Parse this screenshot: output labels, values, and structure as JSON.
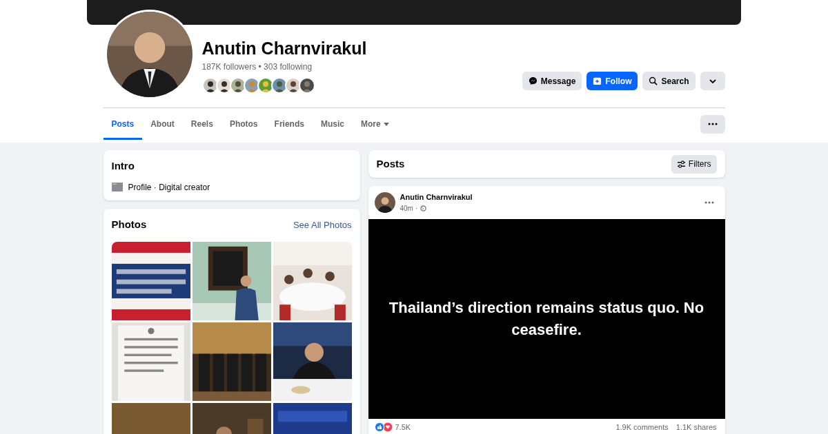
{
  "profile": {
    "name": "Anutin Charnvirakul",
    "stats": "187K followers • 303 following",
    "buttons": [
      {
        "kind": "message",
        "label": "Message"
      },
      {
        "kind": "follow",
        "label": "Follow"
      },
      {
        "kind": "search",
        "label": "Search"
      },
      {
        "kind": "dropdown"
      }
    ]
  },
  "tabs": [
    {
      "label": "Posts",
      "selected": true
    },
    {
      "label": "About",
      "selected": false
    },
    {
      "label": "Reels",
      "selected": false
    },
    {
      "label": "Photos",
      "selected": false
    },
    {
      "label": "Friends",
      "selected": false
    },
    {
      "label": "Music",
      "selected": false
    },
    {
      "label": "More",
      "selected": false,
      "menu": true
    }
  ],
  "intro": {
    "title": "Intro",
    "line": "Profile · Digital creator"
  },
  "photos": {
    "title": "Photos",
    "link": "See All Photos"
  },
  "posts": {
    "title": "Posts",
    "filters": "Filters",
    "post": {
      "author": "Anutin Charnvirakul",
      "time": "40m ·",
      "text": "Thailand’s direction remains status quo. No ceasefire.",
      "reactions": "7.5K",
      "comments": "1.9K comments",
      "shares": "1.1K shares"
    }
  }
}
